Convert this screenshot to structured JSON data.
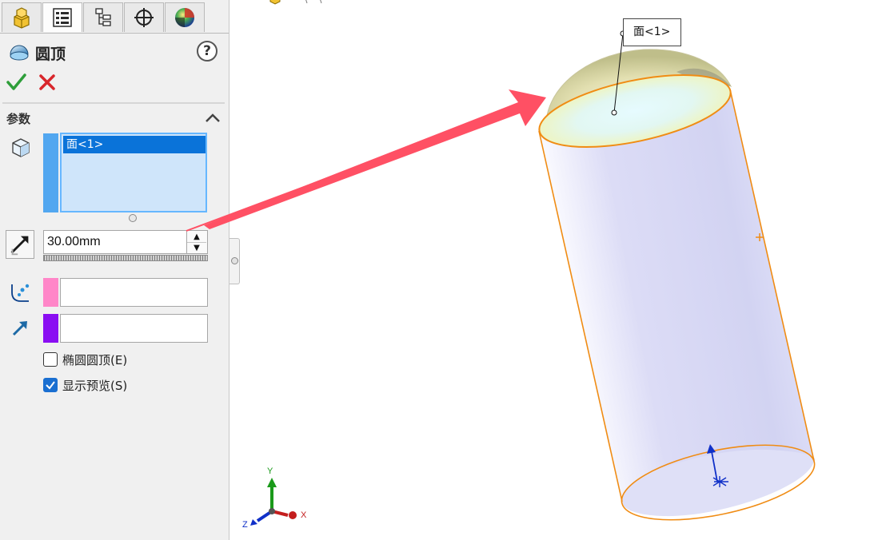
{
  "feature": {
    "title": "圆顶",
    "icon": "dome-icon"
  },
  "tabs": [
    {
      "name": "feature-manager",
      "icon": "feature-manager-icon"
    },
    {
      "name": "property-manager",
      "icon": "property-manager-icon",
      "active": true
    },
    {
      "name": "configuration-manager",
      "icon": "configuration-manager-icon"
    },
    {
      "name": "dimxpert-manager",
      "icon": "crosshair-icon"
    },
    {
      "name": "display-manager",
      "icon": "appearance-sphere-icon"
    }
  ],
  "actions": {
    "help": "?",
    "ok_icon": "green-check-icon",
    "cancel_icon": "red-x-icon"
  },
  "parameters": {
    "section_title": "参数",
    "faces": [
      "面<1>"
    ],
    "distance": "30.00mm",
    "constraint_point": "",
    "direction": "",
    "elliptical_label": "椭圆圆顶(E)",
    "elliptical_checked": false,
    "preview_label": "显示预览(S)",
    "preview_checked": true
  },
  "viewport": {
    "callout_label": "面<1>",
    "triad": {
      "x": "X",
      "y": "Y",
      "z": "Z"
    },
    "colors": {
      "edge": "#f08c14",
      "arrow": "#ff5064",
      "dome": "#e2dfa8",
      "body": "#d7d8f4"
    }
  }
}
